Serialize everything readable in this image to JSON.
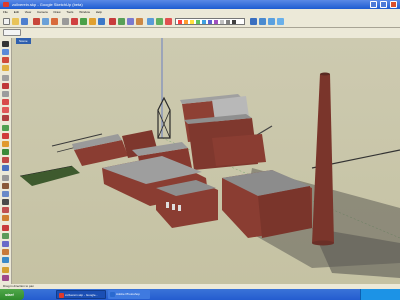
{
  "window": {
    "title": "zollverein.skp - Google SketchUp (beta)"
  },
  "menubar": {
    "items": [
      "File",
      "Edit",
      "View",
      "Camera",
      "Draw",
      "Tools",
      "Window",
      "Help"
    ]
  },
  "scene": {
    "tab_label": "Scene"
  },
  "statusbar": {
    "hint": "Drag in direction to pan"
  },
  "taskbar": {
    "start_label": "start",
    "tasks": [
      "zollverein.skp - Google...",
      "Adobe Photoshop"
    ]
  },
  "colors": {
    "titlebar": "#1e5cd1",
    "viewport": "#c9c6a9",
    "brick": "#8a3d32",
    "roof": "#8f8f8f"
  }
}
